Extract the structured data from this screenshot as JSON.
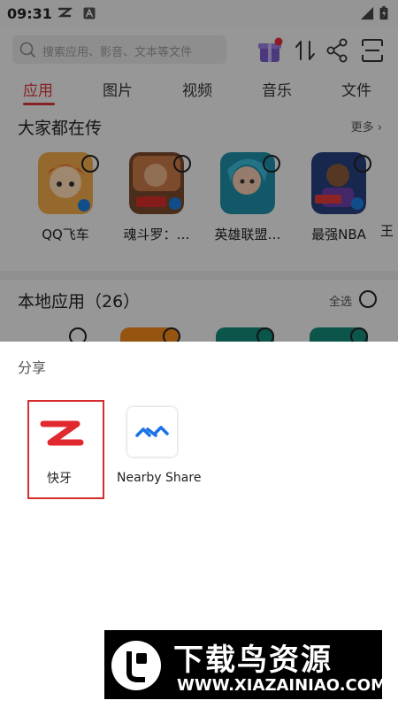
{
  "status_bar": {
    "time": "09:31"
  },
  "search": {
    "placeholder": "搜索应用、影音、文本等文件"
  },
  "tabs": [
    {
      "label": "应用",
      "active": true
    },
    {
      "label": "图片"
    },
    {
      "label": "视频"
    },
    {
      "label": "音乐"
    },
    {
      "label": "文件"
    }
  ],
  "popular": {
    "title": "大家都在传",
    "more": "更多",
    "apps": [
      {
        "name": "QQ飞车",
        "icon": "qq-speed-game-icon"
      },
      {
        "name": "魂斗罗：…",
        "icon": "contra-game-icon"
      },
      {
        "name": "英雄联盟…",
        "icon": "league-of-legends-icon"
      },
      {
        "name": "最强NBA",
        "icon": "nba-game-icon"
      },
      {
        "name": "王"
      }
    ]
  },
  "local": {
    "title": "本地应用（26）",
    "select_all": "全选"
  },
  "share_sheet": {
    "title": "分享",
    "items": [
      {
        "label": "快牙",
        "icon": "kuaiya-icon",
        "selected": true
      },
      {
        "label": "Nearby Share",
        "icon": "nearby-share-icon"
      }
    ]
  },
  "watermark": {
    "title": "下载鸟资源",
    "url": "WWW.XIAZAINIAO.COM"
  },
  "colors": {
    "accent": "#d9373f",
    "overlay": "rgba(0,0,0,0.38)"
  }
}
